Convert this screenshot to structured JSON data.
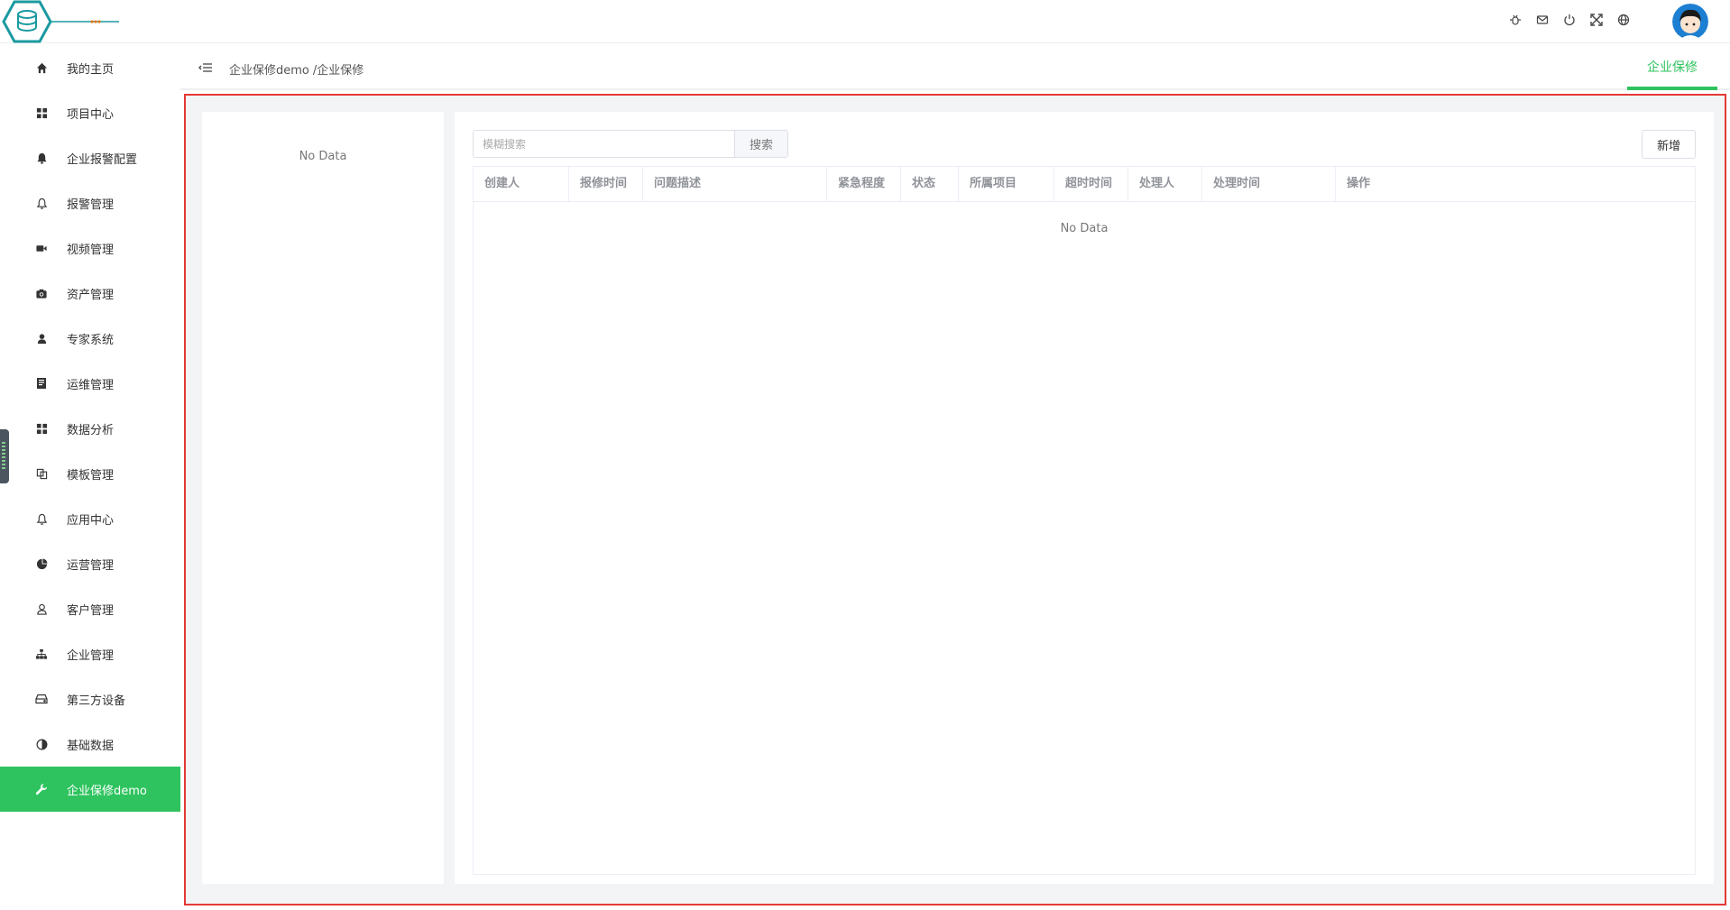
{
  "header": {
    "icons": [
      "bug-icon",
      "mail-icon",
      "power-icon",
      "fullscreen-icon",
      "globe-icon"
    ]
  },
  "sidebar": {
    "items": [
      {
        "label": "我的主页",
        "icon": "home-icon"
      },
      {
        "label": "项目中心",
        "icon": "grid-icon"
      },
      {
        "label": "企业报警配置",
        "icon": "bell-filled-icon"
      },
      {
        "label": "报警管理",
        "icon": "bell-icon"
      },
      {
        "label": "视频管理",
        "icon": "video-icon"
      },
      {
        "label": "资产管理",
        "icon": "camera-icon"
      },
      {
        "label": "专家系统",
        "icon": "user-icon"
      },
      {
        "label": "运维管理",
        "icon": "book-icon"
      },
      {
        "label": "数据分析",
        "icon": "grid-icon"
      },
      {
        "label": "模板管理",
        "icon": "copy-icon"
      },
      {
        "label": "应用中心",
        "icon": "bell-icon"
      },
      {
        "label": "运营管理",
        "icon": "pie-chart-icon"
      },
      {
        "label": "客户管理",
        "icon": "person-outline-icon"
      },
      {
        "label": "企业管理",
        "icon": "org-chart-icon"
      },
      {
        "label": "第三方设备",
        "icon": "drive-icon"
      },
      {
        "label": "基础数据",
        "icon": "contrast-icon"
      },
      {
        "label": "企业保修demo",
        "icon": "wrench-icon",
        "active": true
      }
    ]
  },
  "breadcrumb": {
    "parent": "企业保修demo",
    "current": "/企业保修"
  },
  "tab": {
    "label": "企业保修"
  },
  "left_panel": {
    "empty_text": "No Data"
  },
  "search": {
    "placeholder": "模糊搜索",
    "button_label": "搜索"
  },
  "add_button_label": "新增",
  "table": {
    "columns": [
      {
        "label": "创建人"
      },
      {
        "label": "报修时间"
      },
      {
        "label": "问题描述"
      },
      {
        "label": "紧急程度"
      },
      {
        "label": "状态"
      },
      {
        "label": "所属项目"
      },
      {
        "label": "超时时间"
      },
      {
        "label": "处理人"
      },
      {
        "label": "处理时间"
      },
      {
        "label": "操作"
      }
    ],
    "empty_text": "No Data"
  },
  "colors": {
    "accent": "#2ec35e",
    "highlight_border": "#e53935"
  }
}
